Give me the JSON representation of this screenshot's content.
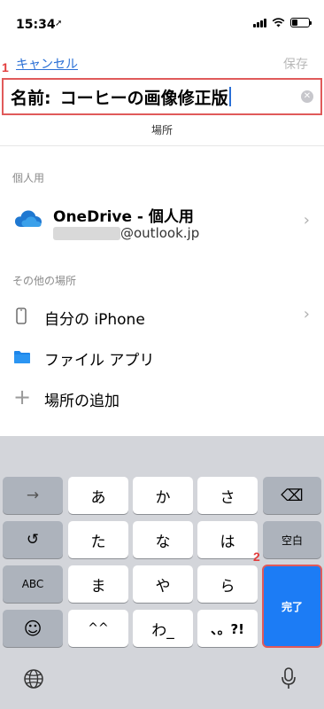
{
  "status": {
    "time": "15:34",
    "location_arrow": "➚"
  },
  "nav": {
    "cancel": "キャンセル",
    "save": "保存"
  },
  "markers": {
    "one": "1",
    "two": "2"
  },
  "name_field": {
    "label": "名前:",
    "value": "コーヒーの画像修正版"
  },
  "place_header": "場所",
  "personal": {
    "section_title": "個人用",
    "onedrive_title": "OneDrive - 個人用",
    "onedrive_account": "@outlook.jp"
  },
  "other": {
    "section_title": "その他の場所",
    "items": [
      {
        "label": "自分の iPhone",
        "icon": "phone-icon"
      },
      {
        "label": "ファイル アプリ",
        "icon": "folder-icon"
      },
      {
        "label": "場所の追加",
        "icon": "plus-icon"
      }
    ]
  },
  "keyboard": {
    "arrow": "→",
    "row1": [
      "あ",
      "か",
      "さ"
    ],
    "row2": [
      "た",
      "な",
      "は"
    ],
    "row3": [
      "ま",
      "や",
      "ら"
    ],
    "row4": [
      "^^",
      "わ_",
      "、。?!"
    ],
    "undo": "↺",
    "abc": "ABC",
    "emoji": "☺",
    "space": "空白",
    "done": "完了",
    "delete": "⌫",
    "globe": "globe-icon",
    "mic": "mic-icon"
  },
  "colors": {
    "accent": "#2a6fd6",
    "done_key": "#1c7cf5",
    "highlight": "#e05a5a"
  }
}
